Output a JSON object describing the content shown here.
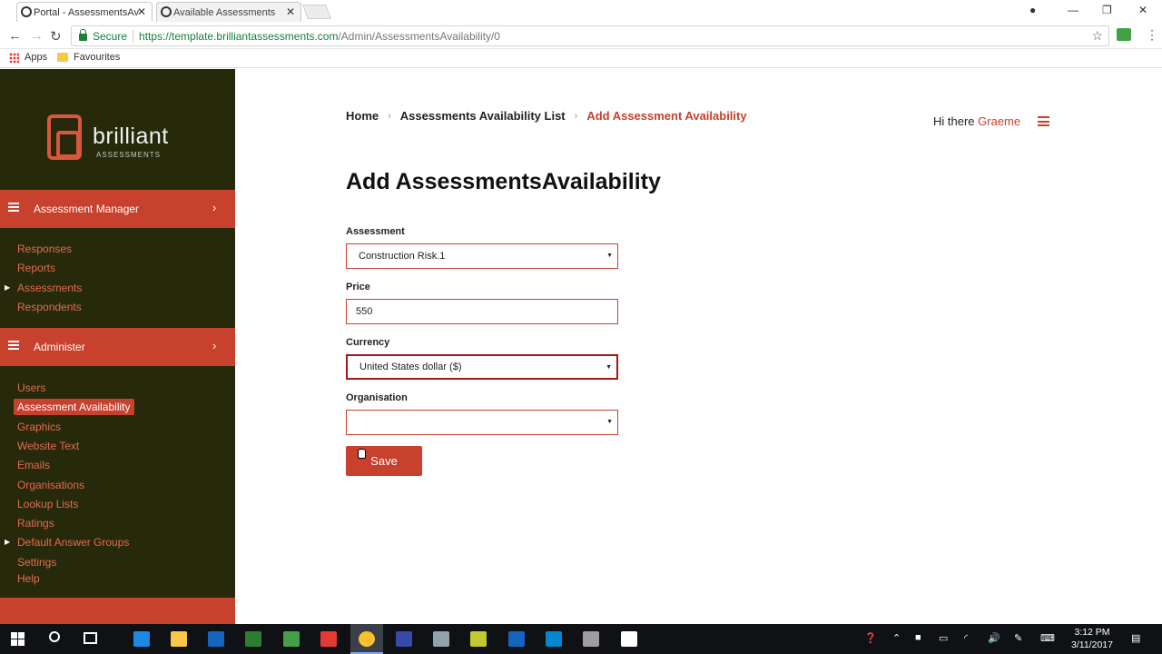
{
  "browser": {
    "tabs": [
      {
        "title": "Portal - AssessmentsAv",
        "active": true
      },
      {
        "title": "Available Assessments",
        "active": false
      }
    ],
    "address": {
      "secure_label": "Secure",
      "url_host": "https://template.brilliantassessments.com",
      "url_path": "/Admin/AssessmentsAvailability/0"
    },
    "bookmarks": [
      {
        "label": "Apps",
        "icon": "apps-grid-icon"
      },
      {
        "label": "Favourites",
        "icon": "folder-icon"
      }
    ]
  },
  "logo": {
    "word": "brilliant",
    "sub": "ASSESSMENTS"
  },
  "sidebar": {
    "assessment_manager": {
      "label": "Assessment Manager",
      "items": [
        {
          "label": "Responses"
        },
        {
          "label": "Reports"
        },
        {
          "label": "Assessments",
          "expandable": true
        },
        {
          "label": "Respondents"
        }
      ]
    },
    "administer": {
      "label": "Administer",
      "items": [
        {
          "label": "Users"
        },
        {
          "label": "Assessment Availability",
          "active": true
        },
        {
          "label": "Graphics"
        },
        {
          "label": "Website Text"
        },
        {
          "label": "Emails"
        },
        {
          "label": "Organisations"
        },
        {
          "label": "Lookup Lists"
        },
        {
          "label": "Ratings"
        },
        {
          "label": "Default Answer Groups",
          "expandable": true
        },
        {
          "label": "Settings"
        },
        {
          "label": "Help"
        }
      ]
    }
  },
  "breadcrumb": {
    "home": "Home",
    "list": "Assessments Availability List",
    "current": "Add Assessment Availability"
  },
  "header": {
    "greeting": "Hi there",
    "user": "Graeme"
  },
  "page": {
    "title": "Add AssessmentsAvailability"
  },
  "form": {
    "assessment": {
      "label": "Assessment",
      "value": "Construction Risk.1"
    },
    "price": {
      "label": "Price",
      "value": "550"
    },
    "currency": {
      "label": "Currency",
      "value": "United States dollar ($)"
    },
    "organisation": {
      "label": "Organisation",
      "value": ""
    },
    "save_label": "Save"
  },
  "taskbar": {
    "time": "3:12 PM",
    "date": "3/11/2017"
  },
  "colors": {
    "accent": "#c7412d",
    "sidebar_bg": "#262a0b",
    "link": "#e46a4f"
  }
}
